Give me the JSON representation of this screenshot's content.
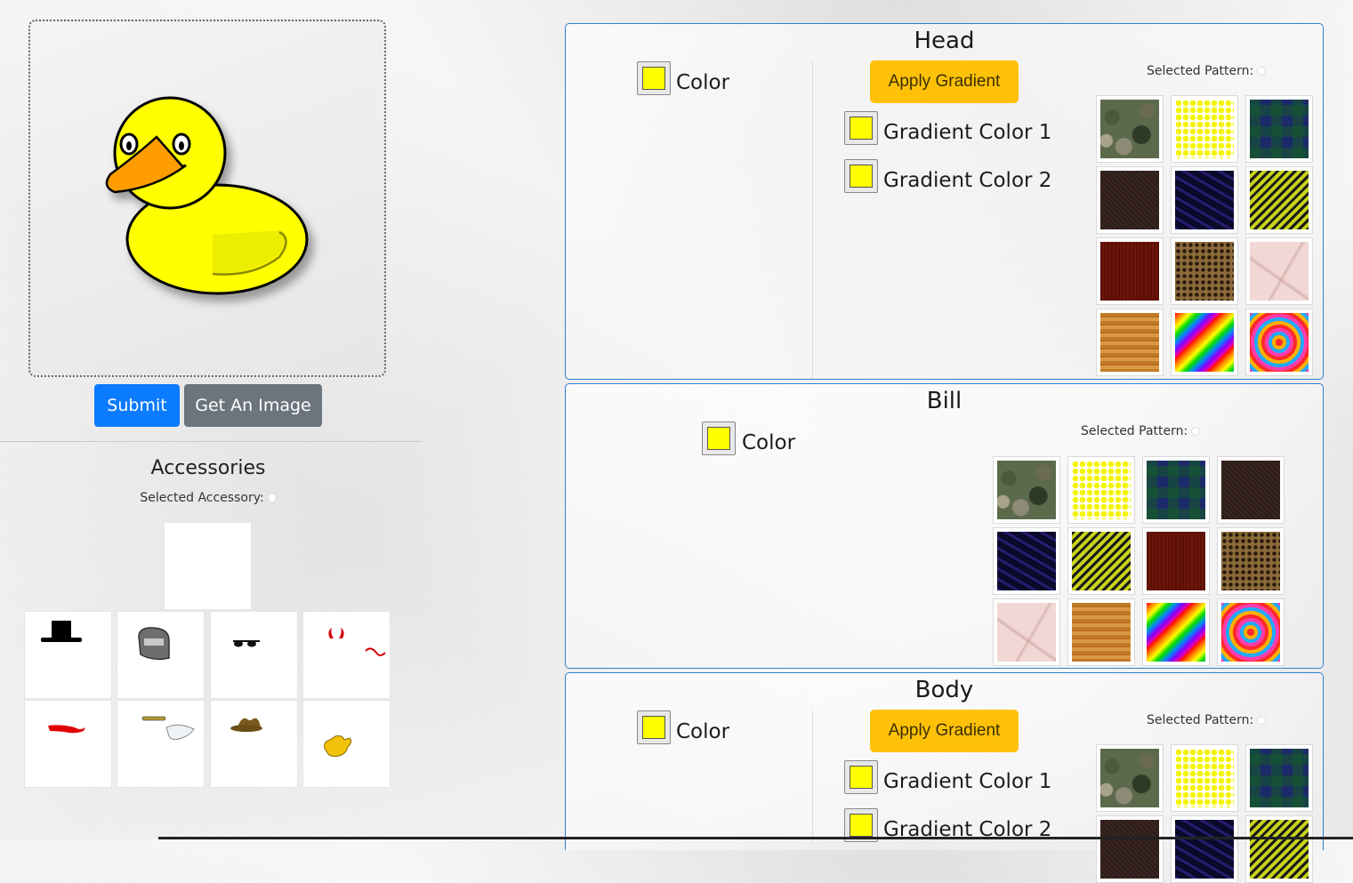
{
  "left": {
    "buttons": {
      "submit": "Submit",
      "get_image": "Get An Image"
    },
    "accessories": {
      "title": "Accessories",
      "selected_label": "Selected Accessory:",
      "items": [
        "top-hat",
        "helmet",
        "sunglasses",
        "devil-horns-tail",
        "red-scarf",
        "halo-wings",
        "cowboy-hat",
        "gloves"
      ]
    }
  },
  "panels": {
    "head": {
      "title": "Head",
      "color_label": "Color",
      "apply_gradient": "Apply Gradient",
      "gradient_color_1": "Gradient Color 1",
      "gradient_color_2": "Gradient Color 2",
      "selected_pattern": "Selected Pattern:"
    },
    "bill": {
      "title": "Bill",
      "color_label": "Color",
      "selected_pattern": "Selected Pattern:"
    },
    "body": {
      "title": "Body",
      "color_label": "Color",
      "apply_gradient": "Apply Gradient",
      "gradient_color_1": "Gradient Color 1",
      "gradient_color_2": "Gradient Color 2",
      "selected_pattern": "Selected Pattern:"
    }
  },
  "patterns": [
    "camo",
    "yellow-dots",
    "plaid",
    "brown",
    "night",
    "yellow-stripes",
    "maroon",
    "leopard",
    "marble",
    "wood",
    "rainbow",
    "tie-dye"
  ],
  "colors": {
    "swatch": "#ffff00",
    "primary": "#0b7bff",
    "secondary": "#6c757d",
    "warning": "#ffc107",
    "panel_border": "#2f7fd3"
  }
}
